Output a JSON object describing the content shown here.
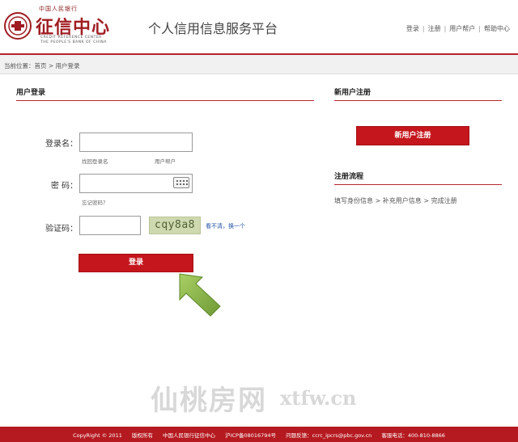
{
  "header": {
    "logo": {
      "org_name": "中国人民银行",
      "name": "征信中心",
      "english_line1": "CREDIT REFERENCE CENTER",
      "english_line2": "THE PEOPLE'S BANK OF CHINA"
    },
    "platform_title": "个人信用信息服务平台",
    "links": [
      "登录",
      "注册",
      "用户帮户",
      "帮助中心"
    ]
  },
  "breadcrumb": {
    "text": "当前位置：首页 > 用户登录"
  },
  "login": {
    "title": "用户登录",
    "username_label": "登录名：",
    "username_value": "",
    "find_username_link": "找回登录名",
    "account_link": "用户帮户",
    "password_label": "密  码：",
    "password_value": "",
    "forgot_password_link": "忘记密码？",
    "captcha_label": "验证码：",
    "captcha_value": "",
    "captcha_image_text": "cqy8a8",
    "refresh_captcha_link": "看不清，换一个",
    "login_button": "登录"
  },
  "register": {
    "title": "新用户注册",
    "register_button": "新用户注册",
    "flow_title": "注册流程",
    "flow_steps": "填写身份信息 > 补充用户信息 > 完成注册"
  },
  "watermark": {
    "text": "仙桃房网",
    "url": "xtfw.cn"
  },
  "footer": {
    "copyright": "CopyRight © 2011",
    "rights": "版权所有",
    "owner": "中国人民银行征信中心",
    "icp": "沪ICP备08016794号",
    "feedback": "问题反馈：ccrc_ipcrs@pbc.gov.cn",
    "phone": "客服电话：400-810-8866"
  },
  "colors": {
    "brand_red": "#c4161c",
    "arrow_green": "#8db84a"
  },
  "icons": {
    "seal": "seal-logo-icon",
    "keyboard": "keyboard-icon",
    "arrow": "up-left-arrow-icon"
  }
}
